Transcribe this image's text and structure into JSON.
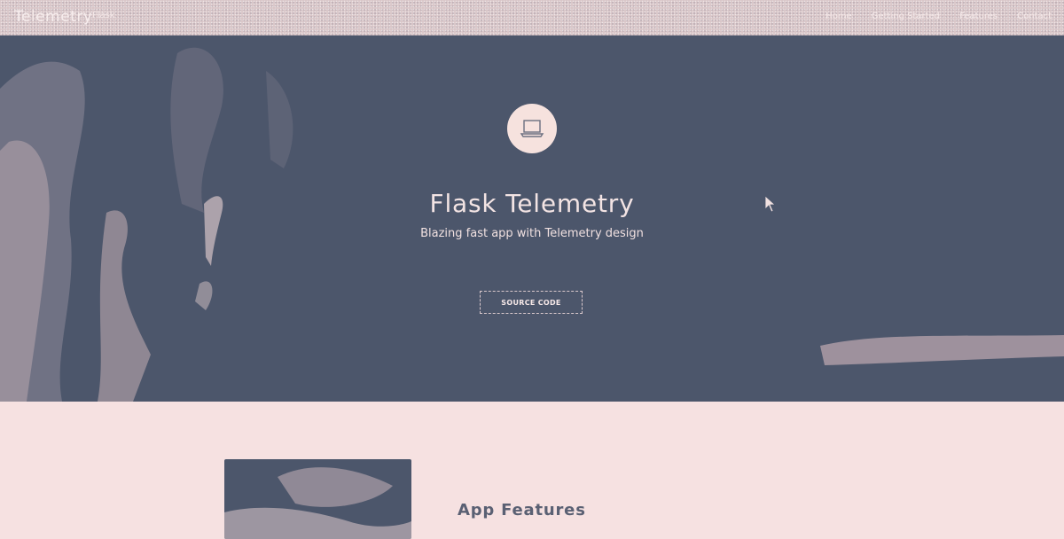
{
  "topbar": {
    "brand": "Telemetry",
    "badge": "Flask",
    "nav": [
      "Home",
      "Getting Started",
      "Features",
      "Contact"
    ]
  },
  "hero": {
    "icon": "laptop-icon",
    "title": "Flask Telemetry",
    "subtitle": "Blazing fast app with Telemetry design",
    "button_label": "SOURCE CODE"
  },
  "features": {
    "title": "App Features"
  },
  "colors": {
    "hero_bg": "#4c566b",
    "page_bg": "#f6e1e1",
    "accent": "#f6e2de"
  }
}
